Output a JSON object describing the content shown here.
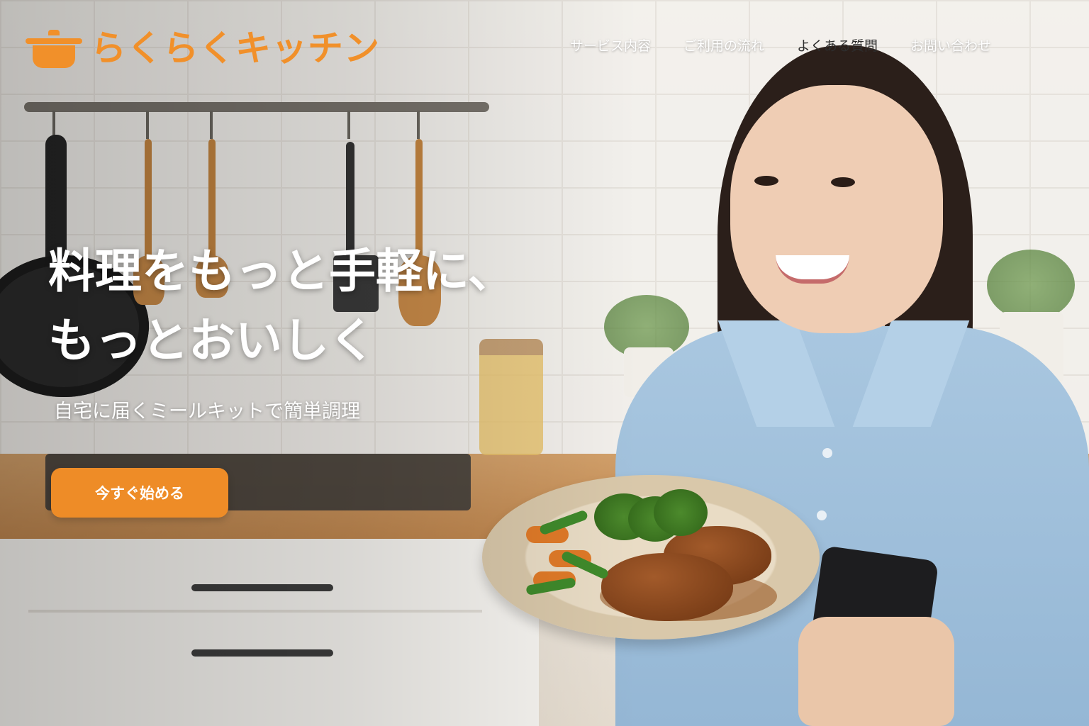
{
  "brand": {
    "name": "らくらくキッチン",
    "color": "#f1902a",
    "icon": "pot-icon"
  },
  "nav": {
    "items": [
      {
        "label": "サービス内容"
      },
      {
        "label": "ご利用の流れ"
      },
      {
        "label": "よくある質問"
      },
      {
        "label": "お問い合わせ"
      }
    ]
  },
  "hero": {
    "headline_line1": "料理をもっと手軽に、",
    "headline_line2": "もっとおいしく",
    "subheadline": "自宅に届くミールキットで簡単調理",
    "cta_label": "今すぐ始める",
    "cta_color": "#ee8c27"
  }
}
